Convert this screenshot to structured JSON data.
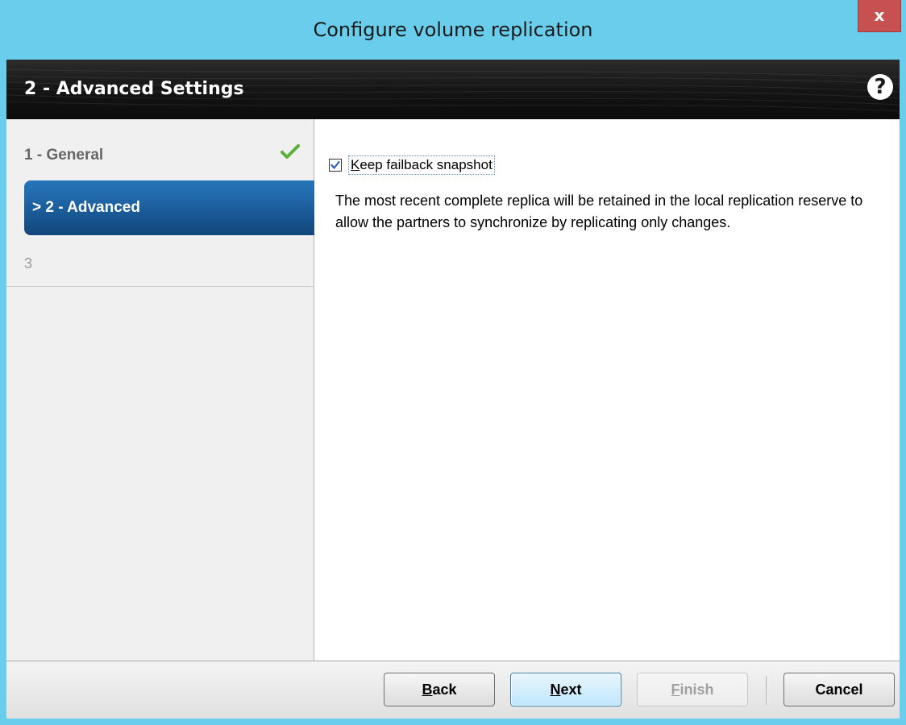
{
  "window": {
    "title": "Configure volume replication",
    "close_label": "x"
  },
  "header": {
    "title": "2 - Advanced Settings",
    "help_label": "?"
  },
  "steps": [
    {
      "label": "1 - General",
      "state": "completed"
    },
    {
      "label": "> 2 - Advanced",
      "state": "current"
    },
    {
      "label": "3",
      "state": "disabled"
    }
  ],
  "content": {
    "checkbox": {
      "accel": "K",
      "label_rest": "eep failback snapshot",
      "checked": true
    },
    "description": "The most recent complete replica will be retained in the local replication reserve to allow the partners to synchronize by replicating only changes."
  },
  "footer": {
    "back": {
      "accel": "B",
      "rest": "ack"
    },
    "next": {
      "accel": "N",
      "rest": "ext"
    },
    "finish": {
      "accel": "F",
      "rest": "inish",
      "enabled": false
    },
    "cancel": "Cancel"
  },
  "colors": {
    "titlebar": "#6bcdec",
    "close": "#c75050",
    "header_band": "#151515",
    "active_step": "#1b5c9a",
    "check_green": "#5cb039"
  }
}
